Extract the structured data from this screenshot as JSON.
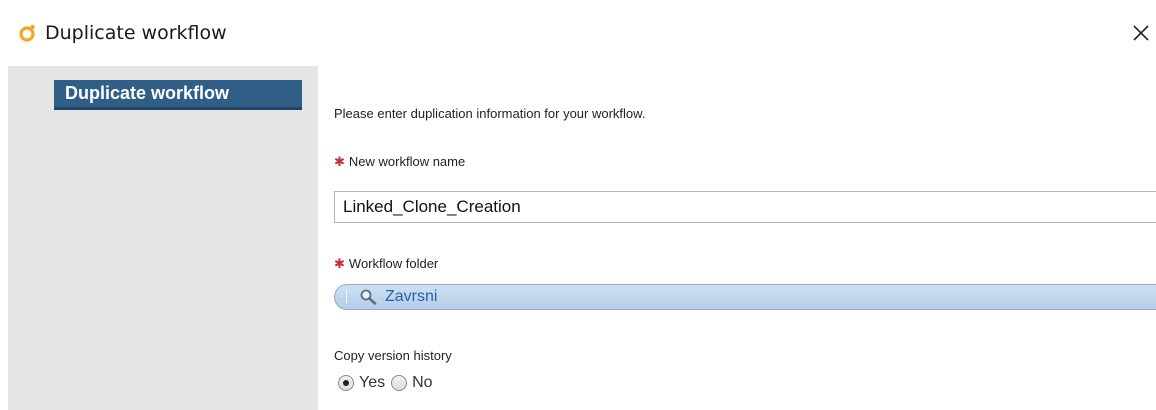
{
  "window": {
    "title": "Duplicate workflow",
    "app_icon": "orchestrator-icon",
    "close_icon": "close-icon",
    "brand_color": "#f5a623"
  },
  "sidebar": {
    "items": [
      {
        "label": "Duplicate workflow",
        "active": true,
        "active_color": "#2f5f87"
      }
    ]
  },
  "form": {
    "intro": "Please enter duplication information for your workflow.",
    "name_field": {
      "label": "New workflow name",
      "required": true,
      "value": "Linked_Clone_Creation"
    },
    "folder_field": {
      "label": "Workflow folder",
      "required": true,
      "value": "Zavrsni",
      "icon": "search-icon",
      "remove_glyph": "×"
    },
    "version_history": {
      "label": "Copy version history",
      "options": [
        {
          "label": "Yes",
          "selected": true
        },
        {
          "label": "No",
          "selected": false
        }
      ]
    },
    "required_color": "#c62a3e"
  }
}
